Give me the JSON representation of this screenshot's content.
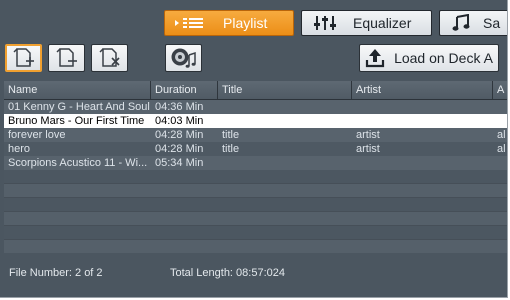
{
  "tabs": [
    {
      "label": "Playlist",
      "icon": "playlist-icon",
      "active": true
    },
    {
      "label": "Equalizer",
      "icon": "equalizer-icon",
      "active": false
    },
    {
      "label": "Sa",
      "icon": "music-note-icon",
      "active": false
    }
  ],
  "toolbar": {
    "add_icon": "add-file-icon",
    "remove_icon": "remove-file-icon",
    "clear_icon": "clear-file-icon",
    "media_icon": "disc-music-icon",
    "load_label": "Load on Deck A",
    "load_icon": "upload-icon"
  },
  "table": {
    "columns": [
      "Name",
      "Duration",
      "Title",
      "Artist",
      "A"
    ],
    "rows": [
      {
        "name": "01 Kenny G - Heart And Soul",
        "duration": "04:36 Min",
        "title": "",
        "artist": "",
        "album": ""
      },
      {
        "name": "Bruno Mars - Our First Time",
        "duration": "04:03 Min",
        "title": "",
        "artist": "",
        "album": ""
      },
      {
        "name": "forever love",
        "duration": "04:28 Min",
        "title": "title",
        "artist": "artist",
        "album": "al"
      },
      {
        "name": "hero",
        "duration": "04:28 Min",
        "title": "title",
        "artist": "artist",
        "album": "al"
      },
      {
        "name": "Scorpions Acustico 11 - Wi...",
        "duration": "05:34 Min",
        "title": "",
        "artist": "",
        "album": ""
      }
    ],
    "selected_row": 1
  },
  "footer": {
    "file_number": "File Number: 2 of 2",
    "total_length": "Total Length: 08:57:024"
  },
  "colors": {
    "accent": "#ec8e17",
    "panel": "#4b5660",
    "selected_row": "#ffffff"
  }
}
